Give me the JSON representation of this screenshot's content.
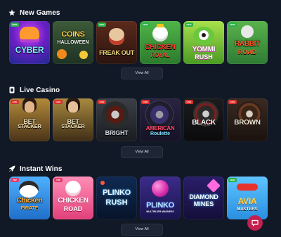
{
  "colors": {
    "background": "#111826",
    "button": "#1e2636",
    "chat": "#c2204e"
  },
  "sections": [
    {
      "title": "New Games",
      "icon": "star-icon",
      "view_all": "View All",
      "tiles": [
        {
          "title": "CYBER",
          "sub": "",
          "badge": "NEW"
        },
        {
          "title": "COINS",
          "sub": "HALLOWEEN",
          "badge": ""
        },
        {
          "title": "FREAK OUT",
          "sub": "",
          "badge": "NEW"
        },
        {
          "title": "CHICKEN",
          "sub": "ROYAL",
          "badge": "NEW"
        },
        {
          "title": "YOMMI",
          "sub": "RUSH",
          "badge": "NEW"
        },
        {
          "title": "RABBIT",
          "sub": "ROAD",
          "badge": "NEW"
        }
      ]
    },
    {
      "title": "Live Casino",
      "icon": "cards-icon",
      "view_all": "View All",
      "tiles": [
        {
          "title": "BET",
          "sub": "STACKER",
          "badge": "LIVE"
        },
        {
          "title": "BET",
          "sub": "STACKER",
          "badge": "LIVE"
        },
        {
          "title": "BRIGHT",
          "sub": "",
          "badge": "LIVE"
        },
        {
          "title": "AMERICAN",
          "sub": "Roulette",
          "badge": "LIVE"
        },
        {
          "title": "BLACK",
          "sub": "",
          "badge": "LIVE"
        },
        {
          "title": "BROWN",
          "sub": "",
          "badge": "LIVE"
        }
      ]
    },
    {
      "title": "Instant Wins",
      "icon": "rocket-icon",
      "view_all": "View All",
      "tiles": [
        {
          "title": "Chicken",
          "sub": "PIRATE",
          "badge": "TOP"
        },
        {
          "title": "CHICKEN",
          "sub": "ROAD",
          "badge": "TOP"
        },
        {
          "title": "PLINKO",
          "sub": "RUSH",
          "badge": ""
        },
        {
          "title": "PLINKO",
          "sub": "MULTIPLIER MADNESS",
          "badge": ""
        },
        {
          "title": "DIAMOND",
          "sub": "MINES",
          "badge": ""
        },
        {
          "title": "AVIA",
          "sub": "MASTERS",
          "badge": "NEW"
        }
      ]
    }
  ]
}
